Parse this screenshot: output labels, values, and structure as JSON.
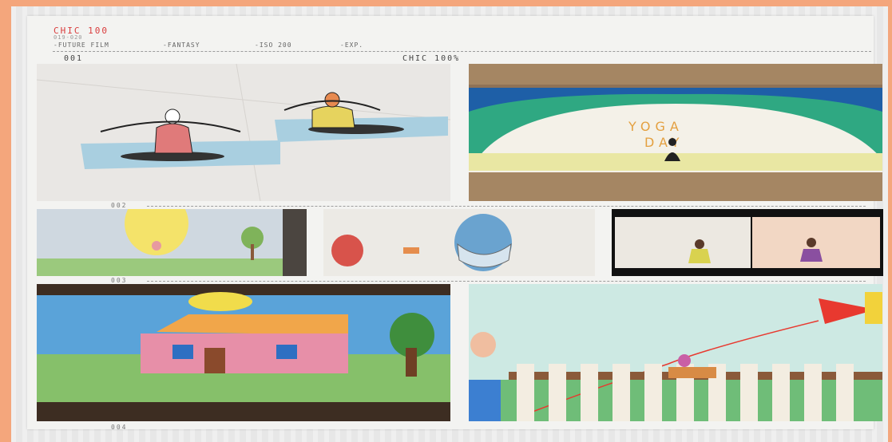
{
  "header": {
    "title": "CHIC 100",
    "subtitle": "019-020",
    "tags": [
      "-FUTURE FILM",
      "-FANTASY",
      "-ISO 200",
      "-EXP."
    ]
  },
  "frame_label_left": "001",
  "frame_label_right": "CHIC 100%",
  "film_numbers": [
    "002",
    "003",
    "004"
  ],
  "photos": {
    "yoga_sketch": {
      "description_color": "#e8e6e2"
    },
    "yoga_day": {
      "text": "YOGA DAY"
    },
    "house": {},
    "kite": {}
  }
}
